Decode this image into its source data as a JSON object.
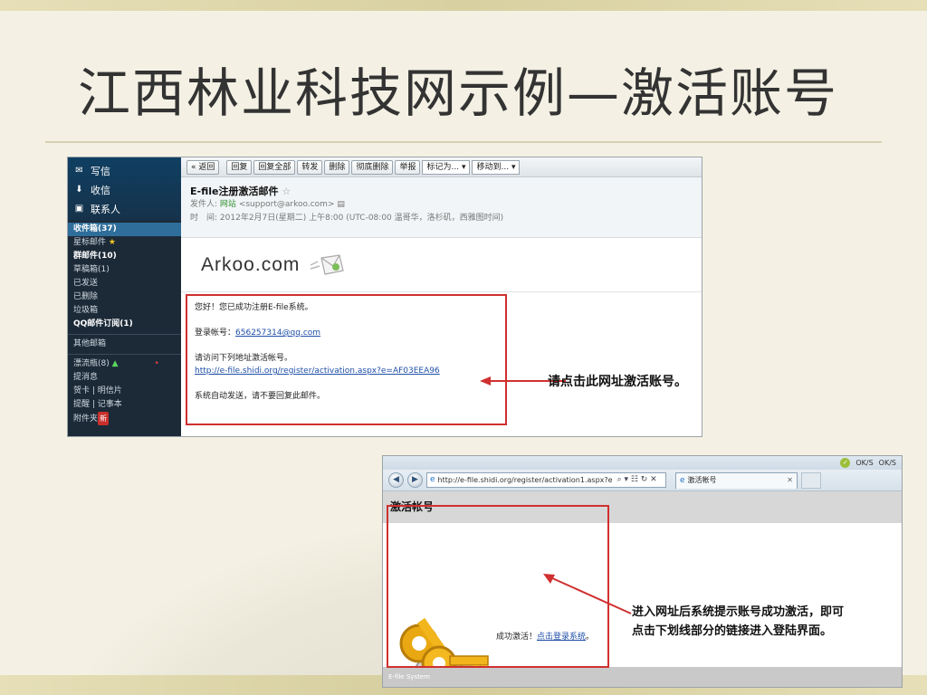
{
  "slide": {
    "title": "江西林业科技网示例—激活账号"
  },
  "mail": {
    "sidebar": {
      "top_items": [
        {
          "icon": "mail-icon",
          "label": "写信"
        },
        {
          "icon": "inbox-icon",
          "label": "收信"
        },
        {
          "icon": "contacts-icon",
          "label": "联系人"
        }
      ],
      "folders": [
        {
          "label": "收件箱(37)"
        },
        {
          "label": "星标邮件"
        },
        {
          "label": "群邮件(10)"
        },
        {
          "label": "草稿箱(1)"
        },
        {
          "label": "已发送"
        },
        {
          "label": "已删除"
        },
        {
          "label": "垃圾箱"
        },
        {
          "label": "QQ邮件订阅(1)"
        }
      ],
      "other_mailbox": "其他邮箱",
      "drift_bottle": "漂流瓶(8)",
      "drift_mark": "▲",
      "misc": [
        "提消息",
        "贺卡 | 明信片",
        "提醒 | 记事本",
        "附件夹"
      ],
      "attach_badge": "新"
    },
    "toolbar": {
      "back": "« 返回",
      "reply": "回复",
      "reply_all": "回复全部",
      "forward": "转发",
      "delete": "删除",
      "delete_forever": "彻底删除",
      "report": "举报",
      "mark_as": "标记为...",
      "move_to": "移动到..."
    },
    "header": {
      "subject": "E-file注册激活邮件",
      "star": "☆",
      "from_label": "发件人:",
      "from_name": "网站",
      "from_email": "<support@arkoo.com>",
      "time_label": "时　间:",
      "time_value": "2012年2月7日(星期二) 上午8:00 (UTC-08:00 温哥华，洛杉矶，西雅图时间)"
    },
    "logo": "Arkoo.com",
    "body": {
      "greeting": "您好！您已成功注册E-file系统。",
      "account_label": "登录帐号：",
      "account_value": "656257314@qq.com",
      "visit_text": "请访问下列地址激活帐号。",
      "activation_url": "http://e-file.shidi.org/register/activation.aspx?e=AF03EEA96",
      "auto_note": "系统自动发送，请不要回复此邮件。"
    },
    "annotation": "请点击此网址激活账号。"
  },
  "browser": {
    "topbar": [
      "OK/S",
      "OK/S"
    ],
    "address": "http://e-file.shidi.org/register/activation1.aspx?e",
    "tab_title": "激活帐号",
    "page_title": "激活帐号",
    "success_text": "成功激活！",
    "login_link": "点击登录系统",
    "after_link": "。",
    "footer": "E-file System",
    "annotation": [
      "进入网址后系统提示账号成功激活，即可",
      "点击下划线部分的链接进入登陆界面。"
    ]
  }
}
